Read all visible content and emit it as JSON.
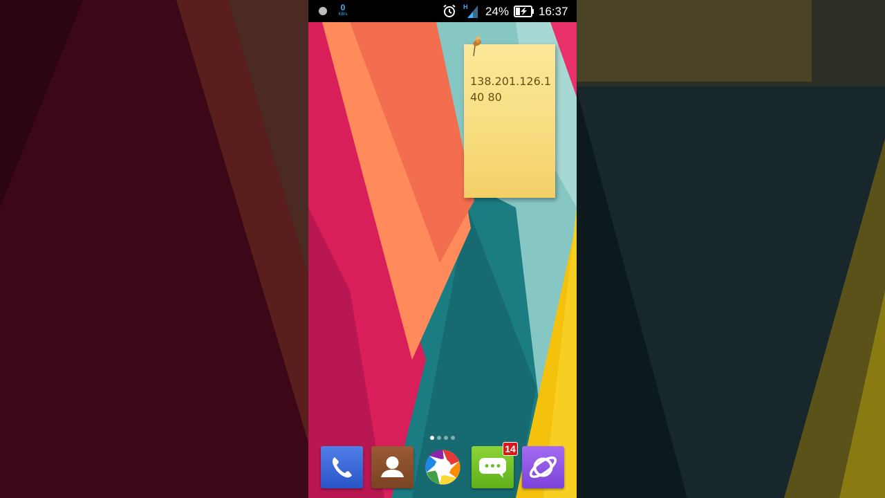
{
  "status_bar": {
    "network_speed_value": "0",
    "network_speed_unit": "KB/s",
    "network_type": "H",
    "battery_percent": "24%",
    "time": "16:37",
    "icons": [
      "notification-dot-icon",
      "alarm-icon",
      "signal-icon",
      "battery-icon"
    ]
  },
  "sticky_note": {
    "text": "138.201.126.140 80"
  },
  "home": {
    "page_count": 4,
    "active_page": 1
  },
  "dock": {
    "apps": [
      {
        "name": "phone",
        "icon": "phone-icon"
      },
      {
        "name": "contacts",
        "icon": "contacts-icon"
      },
      {
        "name": "gallery",
        "icon": "gallery-icon"
      },
      {
        "name": "messages",
        "icon": "messages-icon",
        "badge": "14"
      },
      {
        "name": "browser",
        "icon": "browser-icon"
      }
    ]
  },
  "colors": {
    "wallpaper_red": "#d81f5a",
    "wallpaper_orange": "#ff8a5c",
    "wallpaper_teal": "#1b7c82",
    "wallpaper_mint": "#9fd3cf",
    "wallpaper_yellow": "#f4c20d",
    "note_yellow": "#f8dd7f",
    "badge_red": "#d41a1a",
    "speed_blue": "#3fb3ff"
  }
}
